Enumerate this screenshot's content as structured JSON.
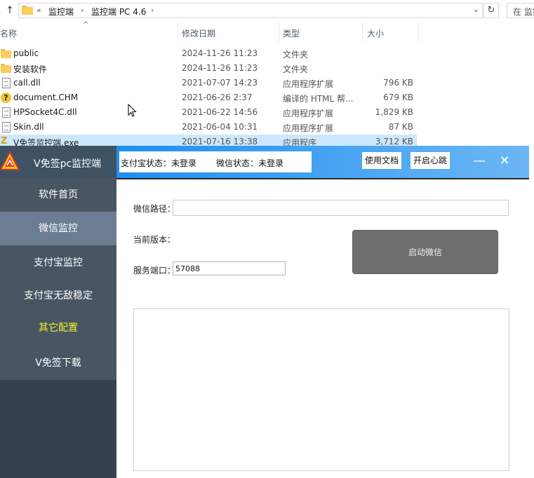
{
  "explorer": {
    "address": {
      "overflow": "«",
      "crumbs": [
        "监控端",
        "监控端 PC 4.6"
      ],
      "separator": "›",
      "dropdown": "⌄",
      "refresh": "↻",
      "search_placeholder": "在 监控"
    },
    "columns": {
      "name": "名称",
      "date": "修改日期",
      "type": "类型",
      "size": "大小"
    },
    "files": [
      {
        "icon": "folder-icon",
        "name": "public",
        "date": "2024-11-26 11:23",
        "type": "文件夹",
        "size": ""
      },
      {
        "icon": "folder-icon",
        "name": "安装软件",
        "date": "2024-11-26 11:23",
        "type": "文件夹",
        "size": ""
      },
      {
        "icon": "dll-file-icon",
        "name": "call.dll",
        "date": "2021-07-07 14:23",
        "type": "应用程序扩展",
        "size": "796 KB"
      },
      {
        "icon": "help-file-icon",
        "name": "document.CHM",
        "date": "2021-06-26 2:37",
        "type": "编译的 HTML 帮...",
        "size": "679 KB"
      },
      {
        "icon": "dll-file-icon",
        "name": "HPSocket4C.dll",
        "date": "2021-06-22 14:56",
        "type": "应用程序扩展",
        "size": "1,829 KB"
      },
      {
        "icon": "dll-file-icon",
        "name": "Skin.dll",
        "date": "2021-06-04 10:31",
        "type": "应用程序扩展",
        "size": "87 KB"
      },
      {
        "icon": "exe-file-icon",
        "name": "V免签监控端.exe",
        "date": "2021-07-16 13:38",
        "type": "应用程序",
        "size": "3,712 KB"
      }
    ]
  },
  "app": {
    "title": "V免签pc监控端",
    "status": {
      "alipay": "支付宝状态：未登录",
      "wechat": "微信状态：未登录"
    },
    "buttons": {
      "docs": "使用文档",
      "heartbeat": "开启心跳",
      "minimize": "—",
      "close": "✕"
    },
    "sidebar": {
      "items": [
        {
          "label": "软件首页"
        },
        {
          "label": "微信监控"
        },
        {
          "label": "支付宝监控"
        },
        {
          "label": "支付宝无敌稳定"
        },
        {
          "label": "其它配置"
        },
        {
          "label": "V免签下载"
        }
      ]
    },
    "form": {
      "wechat_path_label": "微信路径：",
      "wechat_path_value": "",
      "version_label": "当前版本：",
      "port_label": "服务端口：",
      "port_value": "57088",
      "start_button": "启动微信"
    },
    "log_text": "",
    "colors": {
      "sidebar_bg": "#37414f",
      "sidebar_active": "#6b7c93",
      "highlight_text": "#f2f22a",
      "header_blue": "#1f8ff0",
      "button_gray": "#6e6e6e"
    }
  }
}
